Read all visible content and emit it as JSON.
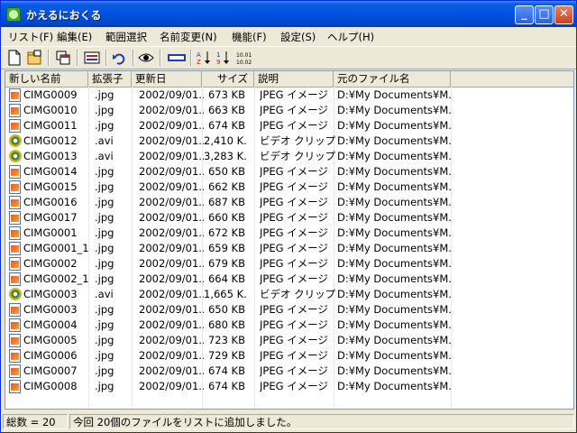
{
  "window": {
    "title": "かえるにおくる"
  },
  "menu": [
    "リスト(F)",
    "編集(E)",
    "範囲選択",
    "名前変更(N)",
    "機能(F)",
    "設定(S)",
    "ヘルプ(H)"
  ],
  "toolbar_icons": [
    "new-list-icon",
    "open-folder-icon",
    "copy-window-icon",
    "rename-icon",
    "undo-icon",
    "preview-eye-icon",
    "all-select-icon",
    "sort-alpha-icon",
    "sort-number-icon",
    "sort-date-icon"
  ],
  "columns": [
    "新しい名前",
    "拡張子",
    "更新日",
    "サイズ",
    "説明",
    "元のファイル名"
  ],
  "rows": [
    {
      "type": "jpg",
      "name": "CIMG0009",
      "ext": ".jpg",
      "date": "2002/09/01...",
      "size": "673 KB",
      "desc": "JPEG イメージ",
      "orig": "D:¥My Documents¥M..."
    },
    {
      "type": "jpg",
      "name": "CIMG0010",
      "ext": ".jpg",
      "date": "2002/09/01...",
      "size": "663 KB",
      "desc": "JPEG イメージ",
      "orig": "D:¥My Documents¥M..."
    },
    {
      "type": "jpg",
      "name": "CIMG0011",
      "ext": ".jpg",
      "date": "2002/09/01...",
      "size": "674 KB",
      "desc": "JPEG イメージ",
      "orig": "D:¥My Documents¥M..."
    },
    {
      "type": "avi",
      "name": "CIMG0012",
      "ext": ".avi",
      "date": "2002/09/01...",
      "size": "2,410 K...",
      "desc": "ビデオ クリップ",
      "orig": "D:¥My Documents¥M..."
    },
    {
      "type": "avi",
      "name": "CIMG0013",
      "ext": ".avi",
      "date": "2002/09/01...",
      "size": "3,283 K...",
      "desc": "ビデオ クリップ",
      "orig": "D:¥My Documents¥M..."
    },
    {
      "type": "jpg",
      "name": "CIMG0014",
      "ext": ".jpg",
      "date": "2002/09/01...",
      "size": "650 KB",
      "desc": "JPEG イメージ",
      "orig": "D:¥My Documents¥M..."
    },
    {
      "type": "jpg",
      "name": "CIMG0015",
      "ext": ".jpg",
      "date": "2002/09/01...",
      "size": "662 KB",
      "desc": "JPEG イメージ",
      "orig": "D:¥My Documents¥M..."
    },
    {
      "type": "jpg",
      "name": "CIMG0016",
      "ext": ".jpg",
      "date": "2002/09/01...",
      "size": "687 KB",
      "desc": "JPEG イメージ",
      "orig": "D:¥My Documents¥M..."
    },
    {
      "type": "jpg",
      "name": "CIMG0017",
      "ext": ".jpg",
      "date": "2002/09/01...",
      "size": "660 KB",
      "desc": "JPEG イメージ",
      "orig": "D:¥My Documents¥M..."
    },
    {
      "type": "jpg",
      "name": "CIMG0001",
      "ext": ".jpg",
      "date": "2002/09/01...",
      "size": "672 KB",
      "desc": "JPEG イメージ",
      "orig": "D:¥My Documents¥M..."
    },
    {
      "type": "jpg",
      "name": "CIMG0001_1",
      "ext": ".jpg",
      "date": "2002/09/01...",
      "size": "659 KB",
      "desc": "JPEG イメージ",
      "orig": "D:¥My Documents¥M..."
    },
    {
      "type": "jpg",
      "name": "CIMG0002",
      "ext": ".jpg",
      "date": "2002/09/01...",
      "size": "679 KB",
      "desc": "JPEG イメージ",
      "orig": "D:¥My Documents¥M..."
    },
    {
      "type": "jpg",
      "name": "CIMG0002_1",
      "ext": ".jpg",
      "date": "2002/09/01...",
      "size": "664 KB",
      "desc": "JPEG イメージ",
      "orig": "D:¥My Documents¥M..."
    },
    {
      "type": "avi",
      "name": "CIMG0003",
      "ext": ".avi",
      "date": "2002/09/01...",
      "size": "1,665 K...",
      "desc": "ビデオ クリップ",
      "orig": "D:¥My Documents¥M..."
    },
    {
      "type": "jpg",
      "name": "CIMG0003",
      "ext": ".jpg",
      "date": "2002/09/01...",
      "size": "650 KB",
      "desc": "JPEG イメージ",
      "orig": "D:¥My Documents¥M..."
    },
    {
      "type": "jpg",
      "name": "CIMG0004",
      "ext": ".jpg",
      "date": "2002/09/01...",
      "size": "680 KB",
      "desc": "JPEG イメージ",
      "orig": "D:¥My Documents¥M..."
    },
    {
      "type": "jpg",
      "name": "CIMG0005",
      "ext": ".jpg",
      "date": "2002/09/01...",
      "size": "723 KB",
      "desc": "JPEG イメージ",
      "orig": "D:¥My Documents¥M..."
    },
    {
      "type": "jpg",
      "name": "CIMG0006",
      "ext": ".jpg",
      "date": "2002/09/01...",
      "size": "729 KB",
      "desc": "JPEG イメージ",
      "orig": "D:¥My Documents¥M..."
    },
    {
      "type": "jpg",
      "name": "CIMG0007",
      "ext": ".jpg",
      "date": "2002/09/01...",
      "size": "674 KB",
      "desc": "JPEG イメージ",
      "orig": "D:¥My Documents¥M..."
    },
    {
      "type": "jpg",
      "name": "CIMG0008",
      "ext": ".jpg",
      "date": "2002/09/01...",
      "size": "674 KB",
      "desc": "JPEG イメージ",
      "orig": "D:¥My Documents¥M..."
    }
  ],
  "status": {
    "count": "総数 = 20",
    "message": "今回 20個のファイルをリストに追加しました。"
  },
  "colors": {
    "title_bar": "#0053e1",
    "close_button": "#c8421c",
    "face": "#ece9d8"
  }
}
